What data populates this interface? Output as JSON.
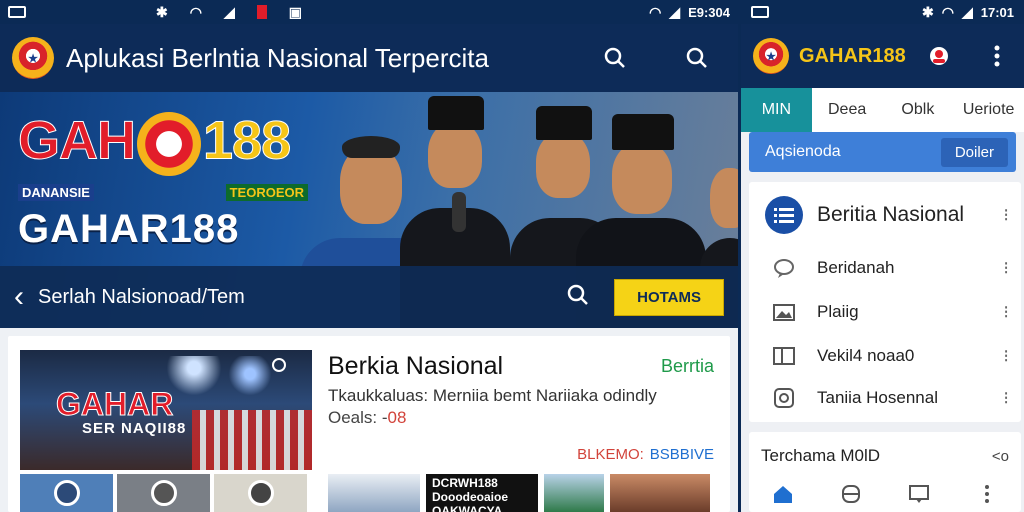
{
  "left": {
    "status": {
      "left_text": "",
      "right_text": "E9:304"
    },
    "appbar": {
      "title": "Aplukasi Berlntia Nasional Terpercita"
    },
    "hero": {
      "brand_part1": "GAH",
      "brand_part2": "188",
      "brand_sub_left": "DANANSIE",
      "brand_sub_right": "TEOROEOR",
      "brand_main": "GAHAR188",
      "crumb": "Serlah Nalsionoad/Tem",
      "cta": "HOTAMS"
    },
    "article": {
      "image_title": "GAHAR",
      "image_sub": "SER NAQII88",
      "title": "Berkia Nasional",
      "tag": "Berrtia",
      "desc": "Tkaukkaluas: Merniia bemt Nariiaka odindly",
      "meta_label": "Oeals: -",
      "meta_value": "08",
      "tag_red": "BLKEMO:",
      "tag_blue": "BSBBIVE",
      "thumb_text": "DCRWH188 Dooodeoaioe OAKWACYA"
    }
  },
  "right": {
    "status": {
      "time": "17:01"
    },
    "appbar": {
      "title": "GAHAR188"
    },
    "tabs": [
      {
        "label": "MIN"
      },
      {
        "label": "Deea"
      },
      {
        "label": "Oblk"
      },
      {
        "label": "Ueriote"
      }
    ],
    "searchbar": {
      "placeholder": "Aqsienoda",
      "button": "Doiler"
    },
    "menu": [
      {
        "label": "Beritia Nasional",
        "icon": "list-icon"
      },
      {
        "label": "Beridanah",
        "icon": "chat-icon"
      },
      {
        "label": "Plaiig",
        "icon": "image-icon"
      },
      {
        "label": "Vekil4 noaa0",
        "icon": "columns-icon"
      },
      {
        "label": "Taniia Hosennal",
        "icon": "clock-icon"
      }
    ],
    "bottom": {
      "label": "Terchama M0lD",
      "nav": "<o"
    }
  },
  "colors": {
    "navy": "#0d2b58",
    "teal": "#17919b",
    "blue": "#3e7fd8",
    "yellow": "#f5d316",
    "red": "#e21d2a",
    "green": "#1f9a4a"
  }
}
